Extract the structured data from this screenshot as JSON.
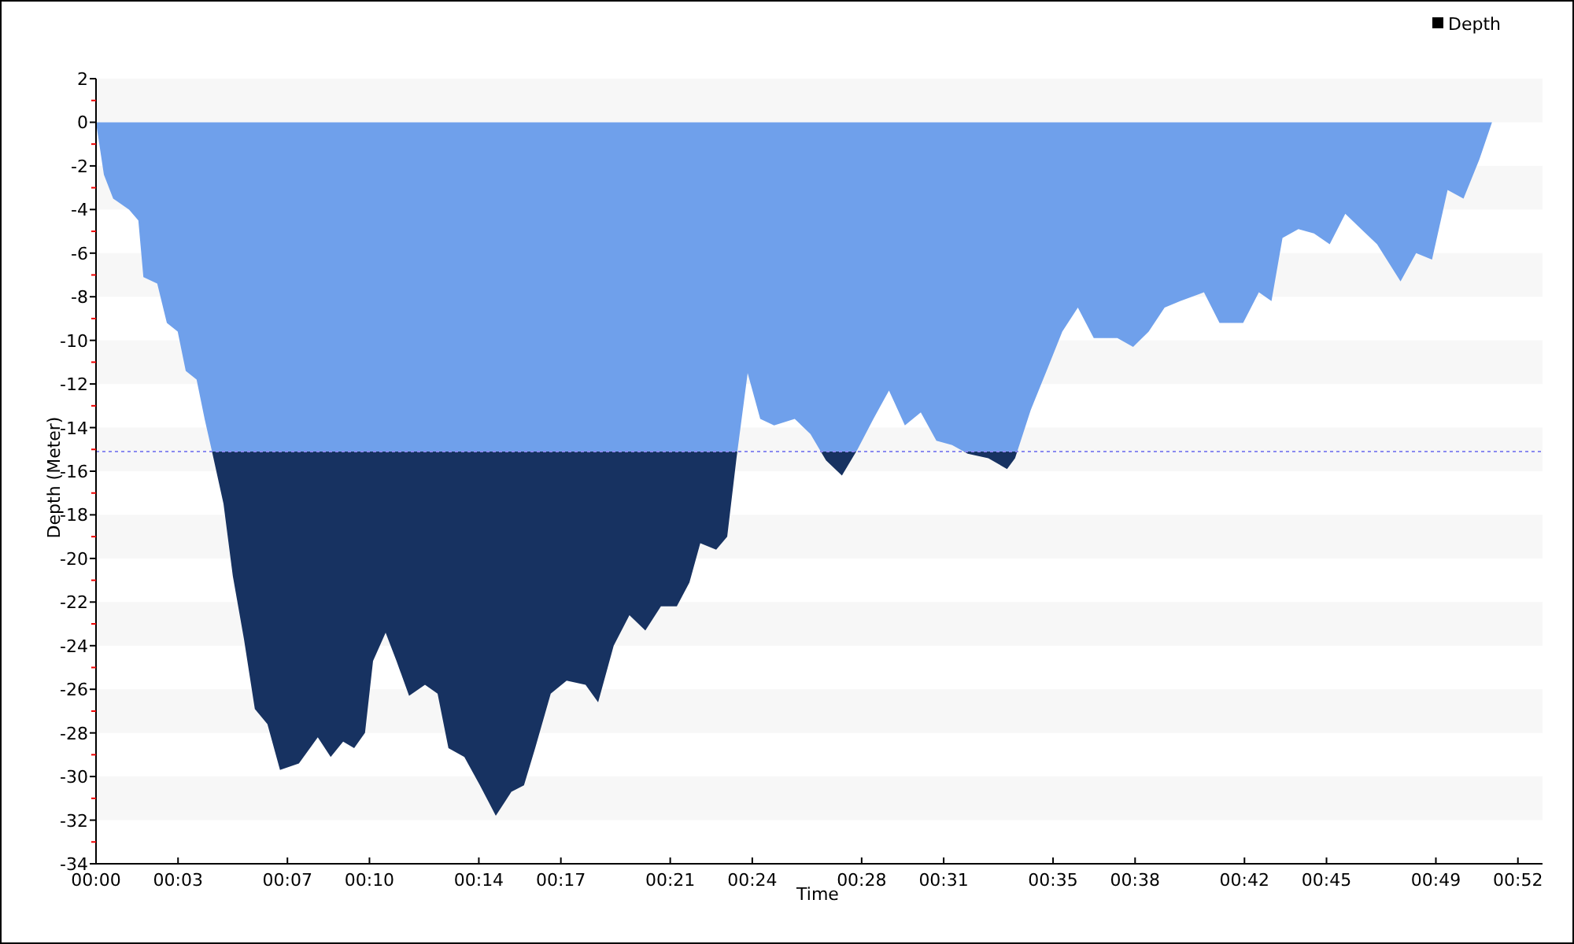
{
  "chart_data": {
    "type": "area",
    "xlabel": "Time",
    "ylabel": "Depth (Meter)",
    "x": [
      0,
      0.29,
      0.63,
      1.21,
      1.55,
      1.73,
      2.24,
      2.59,
      2.99,
      3.28,
      3.68,
      3.97,
      4.26,
      4.66,
      5.0,
      5.41,
      5.81,
      6.27,
      6.73,
      7.42,
      8.11,
      8.58,
      9.04,
      9.44,
      9.84,
      10.13,
      10.59,
      10.99,
      11.45,
      12.03,
      12.49,
      12.89,
      13.47,
      14.04,
      14.62,
      15.19,
      15.65,
      16.06,
      16.63,
      17.21,
      17.9,
      18.36,
      18.93,
      19.51,
      20.09,
      20.66,
      21.24,
      21.7,
      22.1,
      22.68,
      23.08,
      23.42,
      23.83,
      24.29,
      24.8,
      25.55,
      26.13,
      26.7,
      27.28,
      27.85,
      28.43,
      29.0,
      29.58,
      30.16,
      30.73,
      31.31,
      31.88,
      32.63,
      33.32,
      33.61,
      34.18,
      34.76,
      35.34,
      35.91,
      36.49,
      37.35,
      37.93,
      38.5,
      39.08,
      39.65,
      40.52,
      41.09,
      41.95,
      42.53,
      42.99,
      43.39,
      43.97,
      44.54,
      45.12,
      45.69,
      46.27,
      46.85,
      47.71,
      48.28,
      48.86,
      49.43,
      50.01,
      50.59,
      51.05
    ],
    "series": [
      {
        "name": "Depth",
        "color": "#6fa0eb",
        "values": [
          0,
          -2.4,
          -3.5,
          -4.0,
          -4.5,
          -7.1,
          -7.4,
          -9.2,
          -9.6,
          -11.4,
          -11.8,
          -13.6,
          -15.2,
          -17.5,
          -20.8,
          -23.7,
          -26.9,
          -27.6,
          -29.7,
          -29.4,
          -28.2,
          -29.1,
          -28.4,
          -28.7,
          -28.0,
          -24.7,
          -23.4,
          -24.7,
          -26.3,
          -25.8,
          -26.2,
          -28.7,
          -29.1,
          -30.4,
          -31.8,
          -30.7,
          -30.4,
          -28.7,
          -26.2,
          -25.6,
          -25.8,
          -26.6,
          -24.0,
          -22.6,
          -23.3,
          -22.2,
          -22.2,
          -21.1,
          -19.3,
          -19.6,
          -19.0,
          -15.4,
          -11.5,
          -13.6,
          -13.9,
          -13.6,
          -14.3,
          -15.5,
          -16.2,
          -15.0,
          -13.6,
          -12.3,
          -13.9,
          -13.3,
          -14.6,
          -14.8,
          -15.2,
          -15.4,
          -15.9,
          -15.4,
          -13.2,
          -11.4,
          -9.6,
          -8.5,
          -9.9,
          -9.9,
          -10.3,
          -9.6,
          -8.5,
          -8.2,
          -7.8,
          -9.2,
          -9.2,
          -7.8,
          -8.2,
          -5.3,
          -4.9,
          -5.1,
          -5.6,
          -4.2,
          -4.9,
          -5.6,
          -7.3,
          -6.0,
          -6.3,
          -3.1,
          -3.5,
          -1.7,
          0
        ]
      }
    ],
    "xlim": [
      0,
      52.9
    ],
    "ylim": [
      -34,
      2
    ],
    "xticks": [
      {
        "value": 0,
        "label": "00:00"
      },
      {
        "value": 3,
        "label": "00:03"
      },
      {
        "value": 7,
        "label": "00:07"
      },
      {
        "value": 10,
        "label": "00:10"
      },
      {
        "value": 14,
        "label": "00:14"
      },
      {
        "value": 17,
        "label": "00:17"
      },
      {
        "value": 21,
        "label": "00:21"
      },
      {
        "value": 24,
        "label": "00:24"
      },
      {
        "value": 28,
        "label": "00:28"
      },
      {
        "value": 31,
        "label": "00:31"
      },
      {
        "value": 35,
        "label": "00:35"
      },
      {
        "value": 38,
        "label": "00:38"
      },
      {
        "value": 42,
        "label": "00:42"
      },
      {
        "value": 45,
        "label": "00:45"
      },
      {
        "value": 49,
        "label": "00:49"
      },
      {
        "value": 52,
        "label": "00:52"
      }
    ],
    "yticks": [
      2,
      0,
      -2,
      -4,
      -6,
      -8,
      -10,
      -12,
      -14,
      -16,
      -18,
      -20,
      -22,
      -24,
      -26,
      -28,
      -30,
      -32,
      -34
    ],
    "ref_lines": [
      {
        "axis": "y",
        "value": -15.1
      }
    ]
  }
}
